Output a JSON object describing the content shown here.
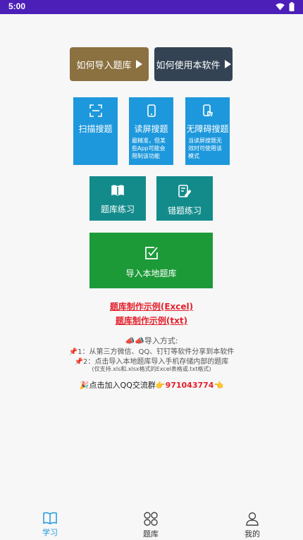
{
  "status_bar": {
    "time": "5:00"
  },
  "help_buttons": {
    "import_help": "如何导入题库",
    "use_help": "如何使用本软件"
  },
  "tiles": {
    "scan": {
      "title": "扫描搜题"
    },
    "read": {
      "title": "读屏搜题",
      "note": "最精准，但某些App可能会限制该功能"
    },
    "access": {
      "title": "无障碍搜题",
      "note": "当读屏搜题无效时可使用该模式"
    },
    "practice": {
      "title": "题库练习"
    },
    "wrong": {
      "title": "错题练习"
    },
    "local_import": {
      "title": "导入本地题库"
    }
  },
  "links": {
    "excel": "题库制作示例(Excel)",
    "txt": "题库制作示例(txt)"
  },
  "instructions": {
    "heading": "📣📣导入方式:",
    "line1": "📌1：从第三方微信、QQ、钉钉等软件分享到本软件",
    "line2": "📌2：点击导入本地题库导入手机存储内部的题库",
    "line3": "(仅支持.xls和.xlsx格式的Excel表格或.txt格式)"
  },
  "qq_group": {
    "prefix": "🎉点击加入QQ交流群👉",
    "number": "971043774",
    "suffix": "👈"
  },
  "bottom_nav": {
    "learn": "学习",
    "bank": "题库",
    "mine": "我的"
  },
  "colors": {
    "status_bar": "#4b1fb8",
    "import_help_btn": "#8b7040",
    "use_help_btn": "#344354",
    "blue_tile": "#1e98dc",
    "teal_tile": "#138b8b",
    "green_tile": "#1d9a38",
    "link_red": "#e4202c",
    "nav_active": "#1e98dc"
  }
}
